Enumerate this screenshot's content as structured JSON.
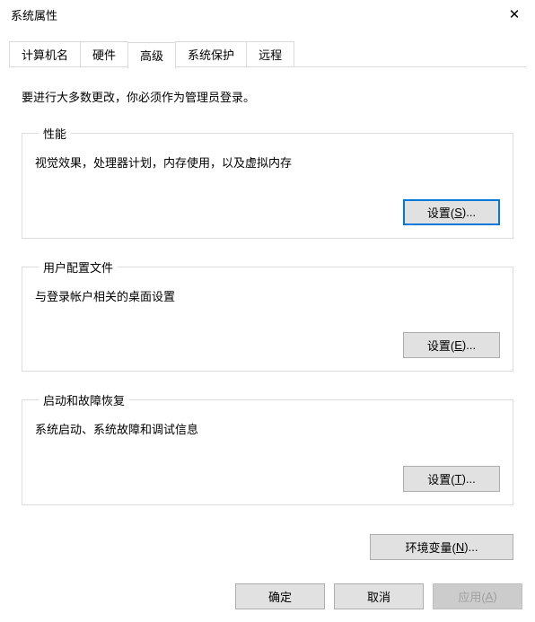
{
  "window": {
    "title": "系统属性",
    "close_label": "✕"
  },
  "tabs": {
    "items": [
      {
        "label": "计算机名"
      },
      {
        "label": "硬件"
      },
      {
        "label": "高级"
      },
      {
        "label": "系统保护"
      },
      {
        "label": "远程"
      }
    ],
    "active_index": 2
  },
  "advanced": {
    "intro": "要进行大多数更改，你必须作为管理员登录。",
    "performance": {
      "legend": "性能",
      "desc": "视觉效果，处理器计划，内存使用，以及虚拟内存",
      "button_prefix": "设置(",
      "button_mnemonic": "S",
      "button_suffix": ")..."
    },
    "profiles": {
      "legend": "用户配置文件",
      "desc": "与登录帐户相关的桌面设置",
      "button_prefix": "设置(",
      "button_mnemonic": "E",
      "button_suffix": ")..."
    },
    "startup": {
      "legend": "启动和故障恢复",
      "desc": "系统启动、系统故障和调试信息",
      "button_prefix": "设置(",
      "button_mnemonic": "T",
      "button_suffix": ")..."
    },
    "env": {
      "button_prefix": "环境变量(",
      "button_mnemonic": "N",
      "button_suffix": ")..."
    }
  },
  "buttons": {
    "ok": "确定",
    "cancel": "取消",
    "apply_prefix": "应用(",
    "apply_mnemonic": "A",
    "apply_suffix": ")"
  }
}
